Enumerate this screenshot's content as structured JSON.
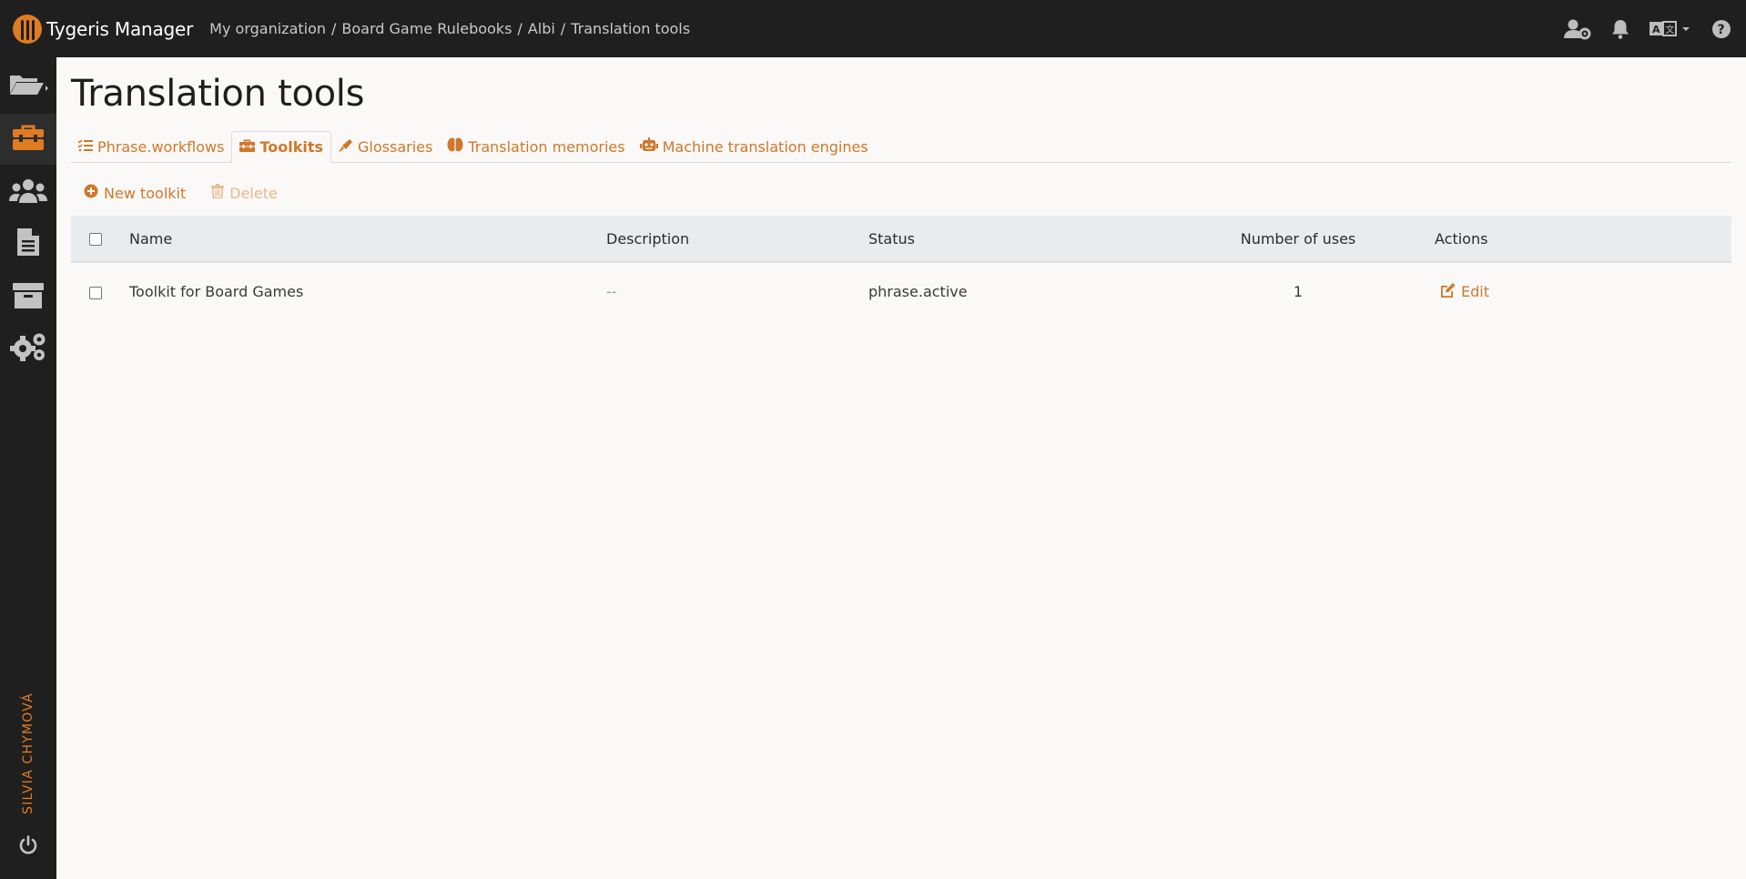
{
  "app": {
    "name": "Tygeris Manager"
  },
  "breadcrumb": [
    "My organization",
    "Board Game Rulebooks",
    "Albi",
    "Translation tools"
  ],
  "colors": {
    "accent": "#e07b22",
    "topbar": "#1f1f1f",
    "background": "#faf9f7"
  },
  "top_icons": [
    "user-cog-icon",
    "bell-icon",
    "language-icon",
    "help-icon"
  ],
  "sidebar": {
    "items": [
      {
        "name": "projects",
        "icon": "folder-open-icon",
        "active": false
      },
      {
        "name": "translation-tools",
        "icon": "toolbox-icon",
        "active": true
      },
      {
        "name": "users",
        "icon": "users-icon",
        "active": false
      },
      {
        "name": "documents",
        "icon": "file-text-icon",
        "active": false
      },
      {
        "name": "archive",
        "icon": "archive-icon",
        "active": false
      },
      {
        "name": "settings",
        "icon": "gears-icon",
        "active": false
      }
    ],
    "user_name": "SILVIA CHYMOVÁ"
  },
  "page": {
    "title": "Translation tools"
  },
  "tabs": [
    {
      "label": "Phrase.workflows",
      "icon": "list-check-icon",
      "active": false
    },
    {
      "label": "Toolkits",
      "icon": "toolbox-icon",
      "active": true
    },
    {
      "label": "Glossaries",
      "icon": "highlighter-icon",
      "active": false
    },
    {
      "label": "Translation memories",
      "icon": "brain-icon",
      "active": false
    },
    {
      "label": "Machine translation engines",
      "icon": "robot-icon",
      "active": false
    }
  ],
  "toolbar": {
    "new_label": "New toolkit",
    "delete_label": "Delete"
  },
  "table": {
    "columns": [
      "Name",
      "Description",
      "Status",
      "Number of uses",
      "Actions"
    ],
    "rows": [
      {
        "name": "Toolkit for Board Games",
        "description": "--",
        "status": "phrase.active",
        "uses": "1",
        "action": "Edit"
      }
    ]
  }
}
